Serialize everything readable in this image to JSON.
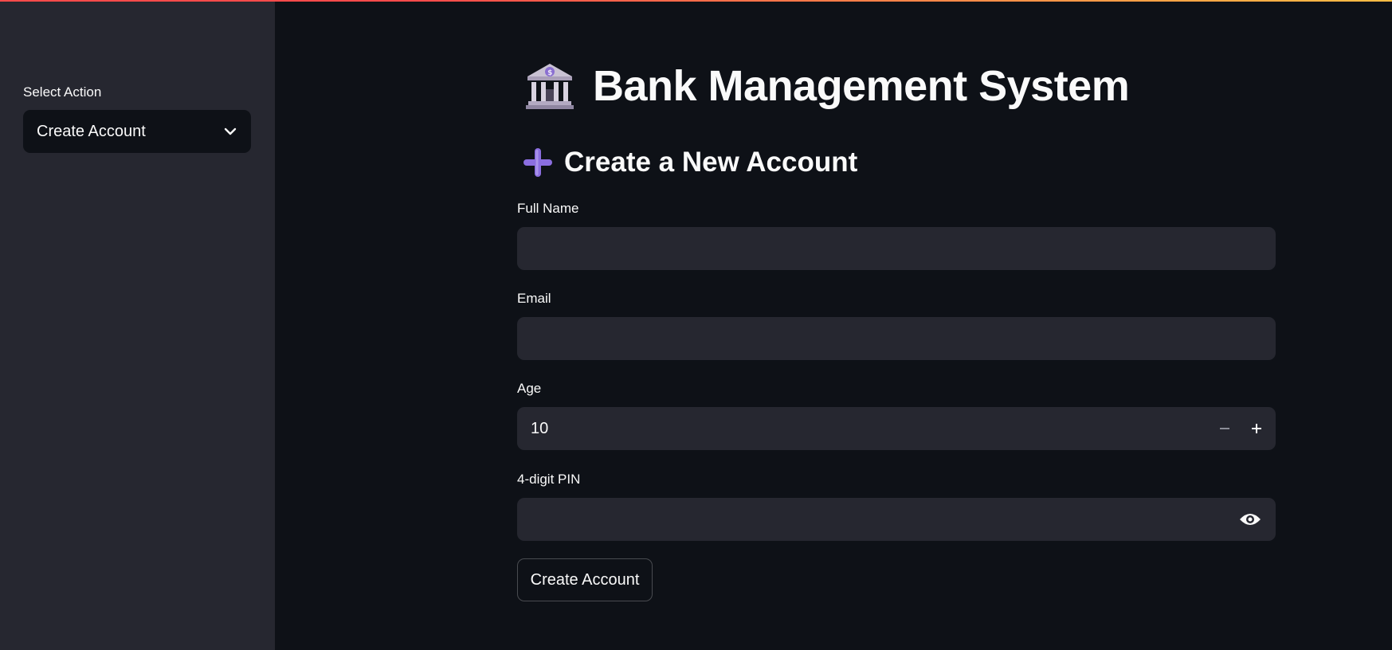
{
  "sidebar": {
    "select_label": "Select Action",
    "select_value": "Create Account"
  },
  "main": {
    "title": "Bank Management System",
    "title_icon": "bank-building-icon",
    "section_title": "Create a New Account",
    "section_icon": "plus-icon",
    "fields": {
      "full_name": {
        "label": "Full Name",
        "value": ""
      },
      "email": {
        "label": "Email",
        "value": ""
      },
      "age": {
        "label": "Age",
        "value": "10"
      },
      "pin": {
        "label": "4-digit PIN",
        "value": ""
      }
    },
    "submit_label": "Create Account"
  },
  "colors": {
    "background": "#0e1117",
    "sidebar": "#262730",
    "input": "#262730",
    "text": "#fafafa",
    "accent": "#ff4b4b"
  }
}
